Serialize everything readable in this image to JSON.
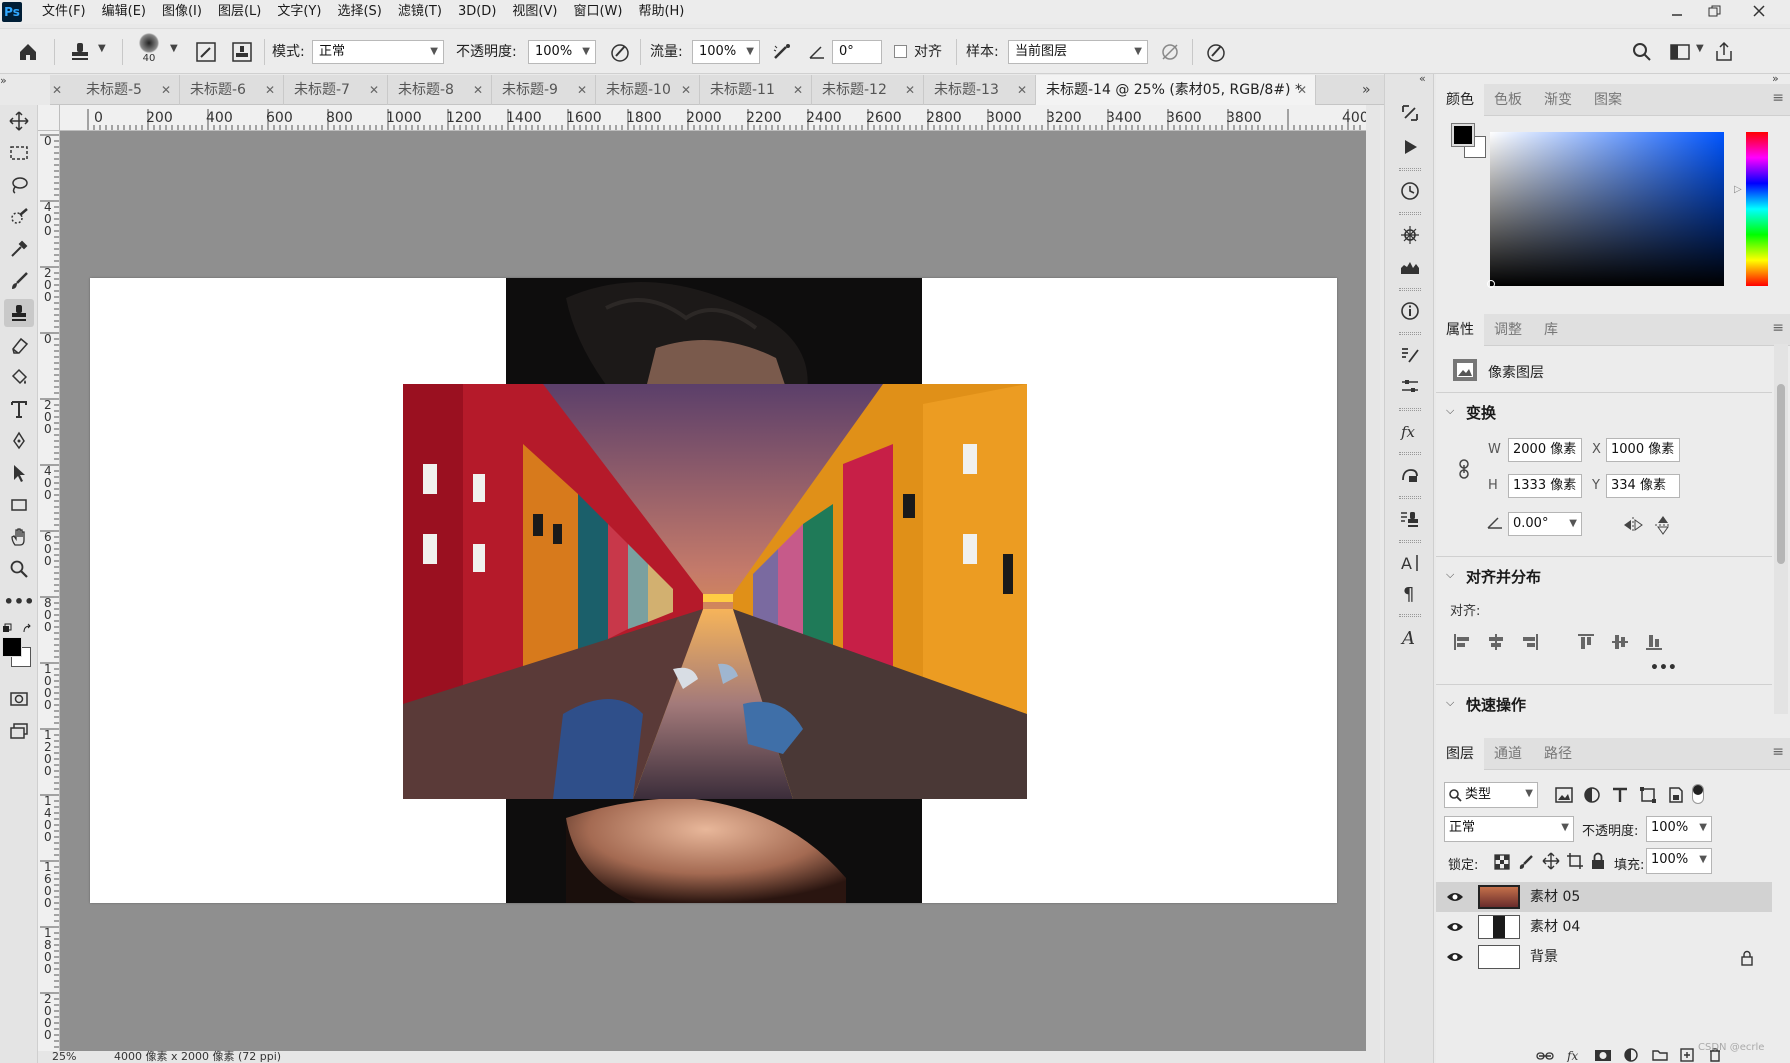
{
  "menubar": {
    "logo": "Ps",
    "items": [
      "文件(F)",
      "编辑(E)",
      "图像(I)",
      "图层(L)",
      "文字(Y)",
      "选择(S)",
      "滤镜(T)",
      "3D(D)",
      "视图(V)",
      "窗口(W)",
      "帮助(H)"
    ]
  },
  "options": {
    "brush_size": "40",
    "mode_label": "模式:",
    "mode_value": "正常",
    "opacity_label": "不透明度:",
    "opacity_value": "100%",
    "flow_label": "流量:",
    "flow_value": "100%",
    "angle_value": "0°",
    "align_label": "对齐",
    "sample_label": "样本:",
    "sample_value": "当前图层"
  },
  "tabs": [
    {
      "label": "未标题-5"
    },
    {
      "label": "未标题-6"
    },
    {
      "label": "未标题-7"
    },
    {
      "label": "未标题-8"
    },
    {
      "label": "未标题-9"
    },
    {
      "label": "未标题-10"
    },
    {
      "label": "未标题-11"
    },
    {
      "label": "未标题-12"
    },
    {
      "label": "未标题-13"
    },
    {
      "label": "未标题-14 @ 25% (素材05, RGB/8#) *"
    }
  ],
  "ruler_h": [
    "0",
    "200",
    "400",
    "600",
    "800",
    "1000",
    "1200",
    "1400",
    "1600",
    "1800",
    "2000",
    "2200",
    "2400",
    "2600",
    "2800",
    "3000",
    "3200",
    "3400",
    "3600",
    "3800",
    "400"
  ],
  "ruler_v": [
    "0",
    "400",
    "200",
    "0",
    "200",
    "400",
    "600",
    "800",
    "1000",
    "1200",
    "1400",
    "1600",
    "1800",
    "2000",
    "2"
  ],
  "status": {
    "zoom": "25%",
    "doc_info": "4000 像素 x 2000 像素 (72 ppi)"
  },
  "color_panel": {
    "tabs": [
      "颜色",
      "色板",
      "渐变",
      "图案"
    ]
  },
  "properties": {
    "tabs": [
      "属性",
      "调整",
      "库"
    ],
    "layer_type": "像素图层",
    "transform_title": "变换",
    "w_label": "W",
    "w_value": "2000 像素",
    "x_label": "X",
    "x_value": "1000 像素",
    "h_label": "H",
    "h_value": "1333 像素",
    "y_label": "Y",
    "y_value": "334 像素",
    "angle_value": "0.00°",
    "align_title": "对齐并分布",
    "align_label": "对齐:",
    "quick_title": "快速操作"
  },
  "layers_panel": {
    "tabs": [
      "图层",
      "通道",
      "路径"
    ],
    "filter_label": "类型",
    "blend_mode": "正常",
    "opacity_label": "不透明度:",
    "opacity_value": "100%",
    "lock_label": "锁定:",
    "fill_label": "填充:",
    "fill_value": "100%",
    "layers": [
      {
        "name": "素材 05",
        "selected": true
      },
      {
        "name": "素材 04",
        "selected": false
      },
      {
        "name": "背景",
        "selected": false
      }
    ]
  },
  "watermark": "CSDN @ecrle",
  "colors": {
    "accent": "#31a8ff",
    "pasteboard": "#8f8f8f"
  }
}
